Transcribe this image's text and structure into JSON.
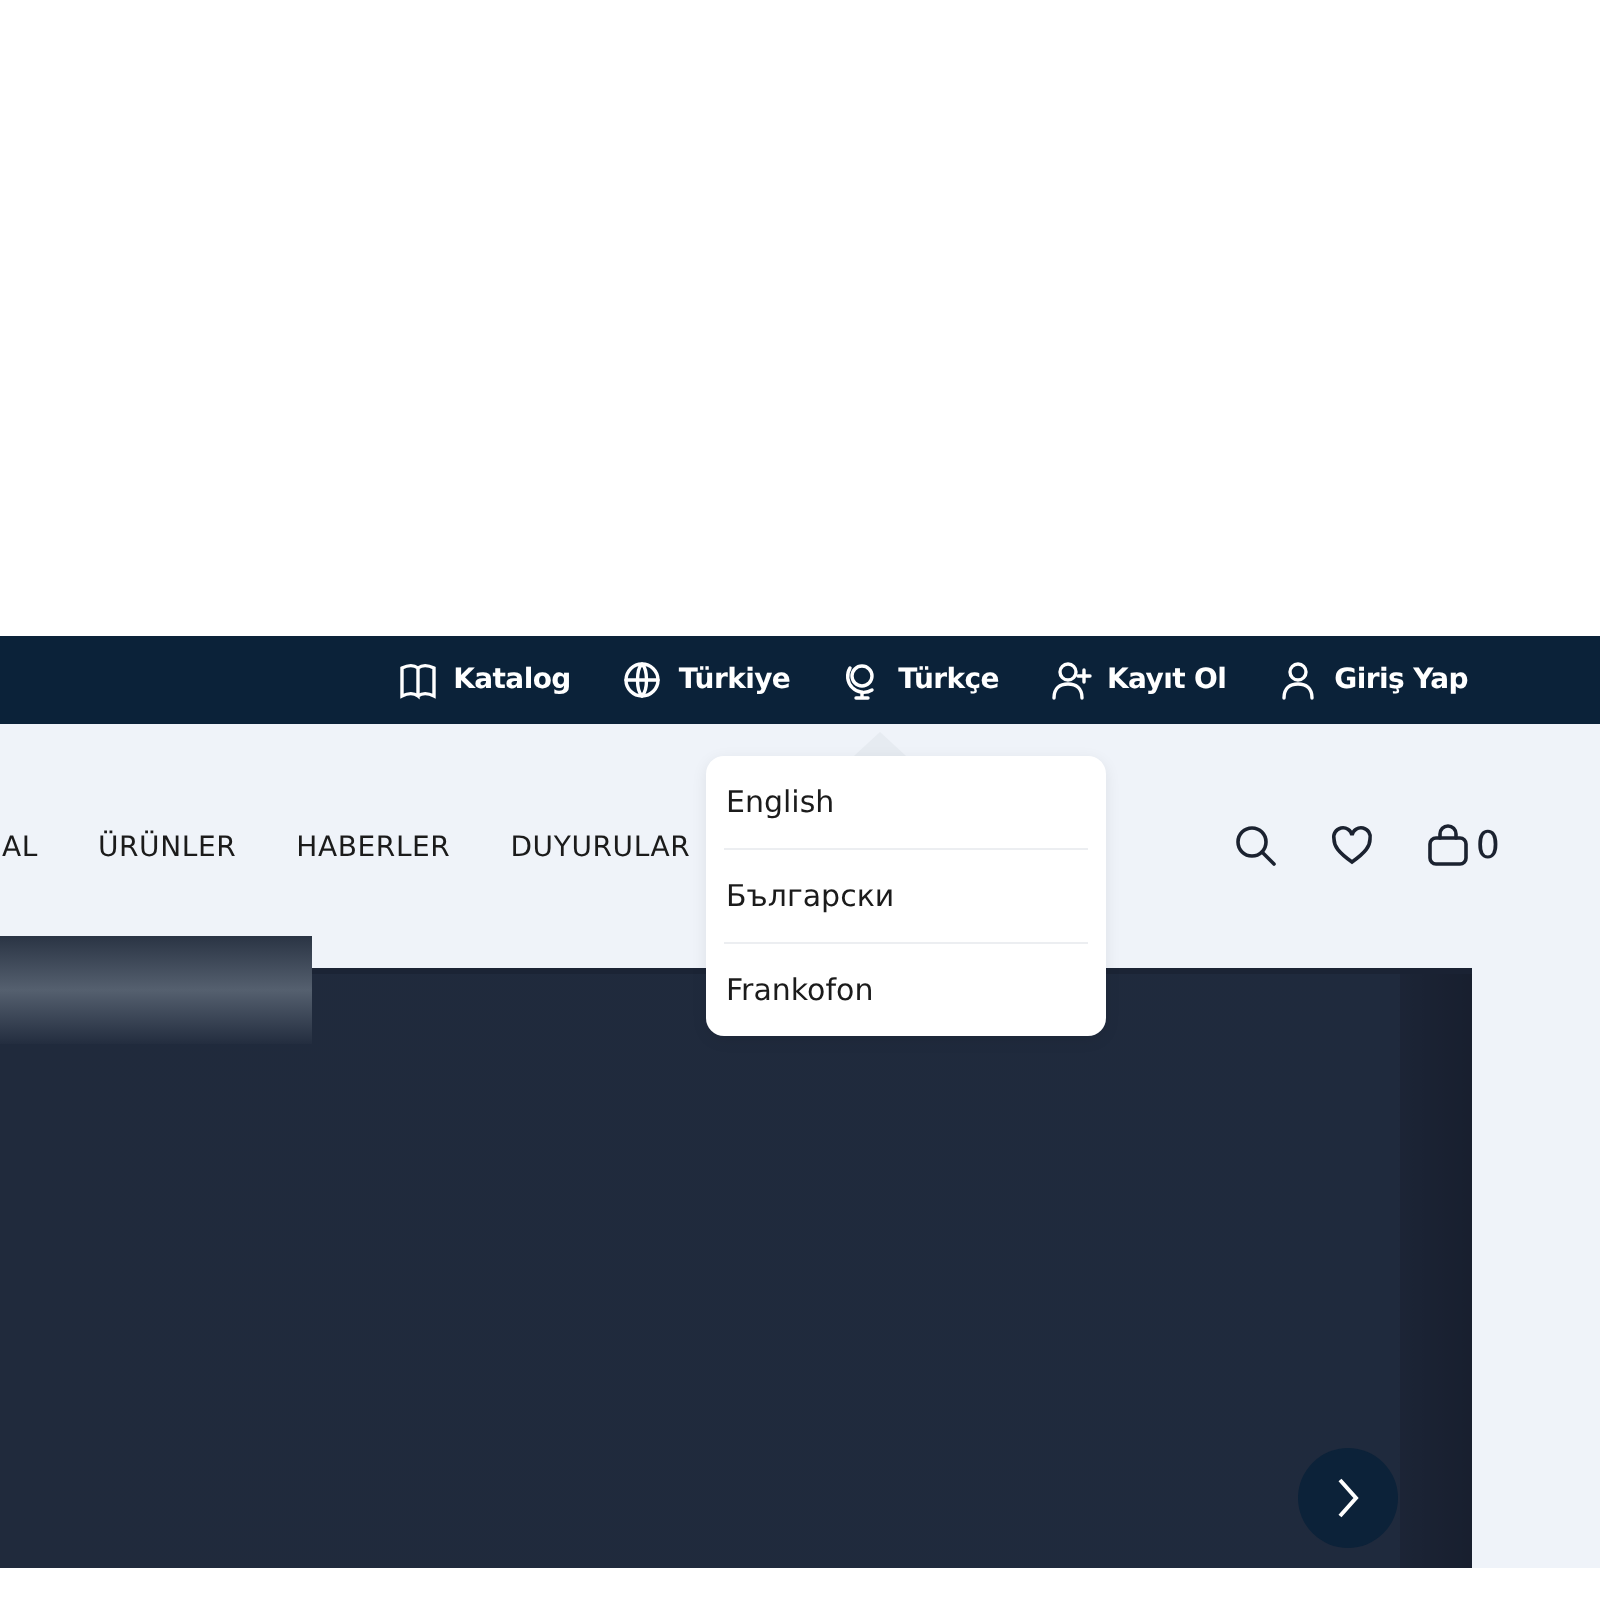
{
  "top_bar": {
    "items": [
      {
        "label": "Katalog"
      },
      {
        "label": "Türkiye"
      },
      {
        "label": "Türkçe"
      },
      {
        "label": "Kayıt Ol"
      },
      {
        "label": "Giriş Yap"
      }
    ]
  },
  "nav": {
    "items": [
      "AL",
      "ÜRÜNLER",
      "HABERLER",
      "DUYURULAR"
    ]
  },
  "cart": {
    "count": "0"
  },
  "language_menu": {
    "items": [
      "English",
      "Български",
      "Frankofon"
    ]
  }
}
